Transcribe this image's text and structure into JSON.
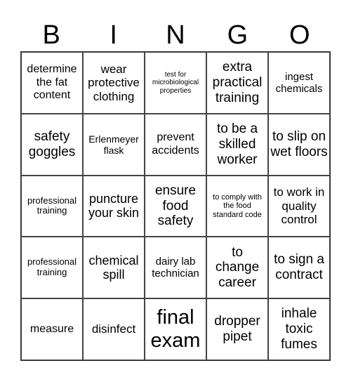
{
  "header": {
    "letters": [
      "B",
      "I",
      "N",
      "G",
      "O"
    ]
  },
  "rows": [
    [
      "determine the fat content",
      "wear protective clothing",
      "test for microbiological properties",
      "extra practical training",
      "ingest chemicals"
    ],
    [
      "safety goggles",
      "Erlenmeyer flask",
      "prevent accidents",
      "to be a skilled worker",
      "to slip on wet floors"
    ],
    [
      "professional training",
      "puncture your skin",
      "ensure food safety",
      "to comply with the food standard code",
      "to work in quality control"
    ],
    [
      "professional training",
      "chemical spill",
      "dairy lab technician",
      "to change career",
      "to sign a contract"
    ],
    [
      "measure",
      "disinfect",
      "final exam",
      "dropper pipet",
      "inhale toxic fumes"
    ]
  ]
}
